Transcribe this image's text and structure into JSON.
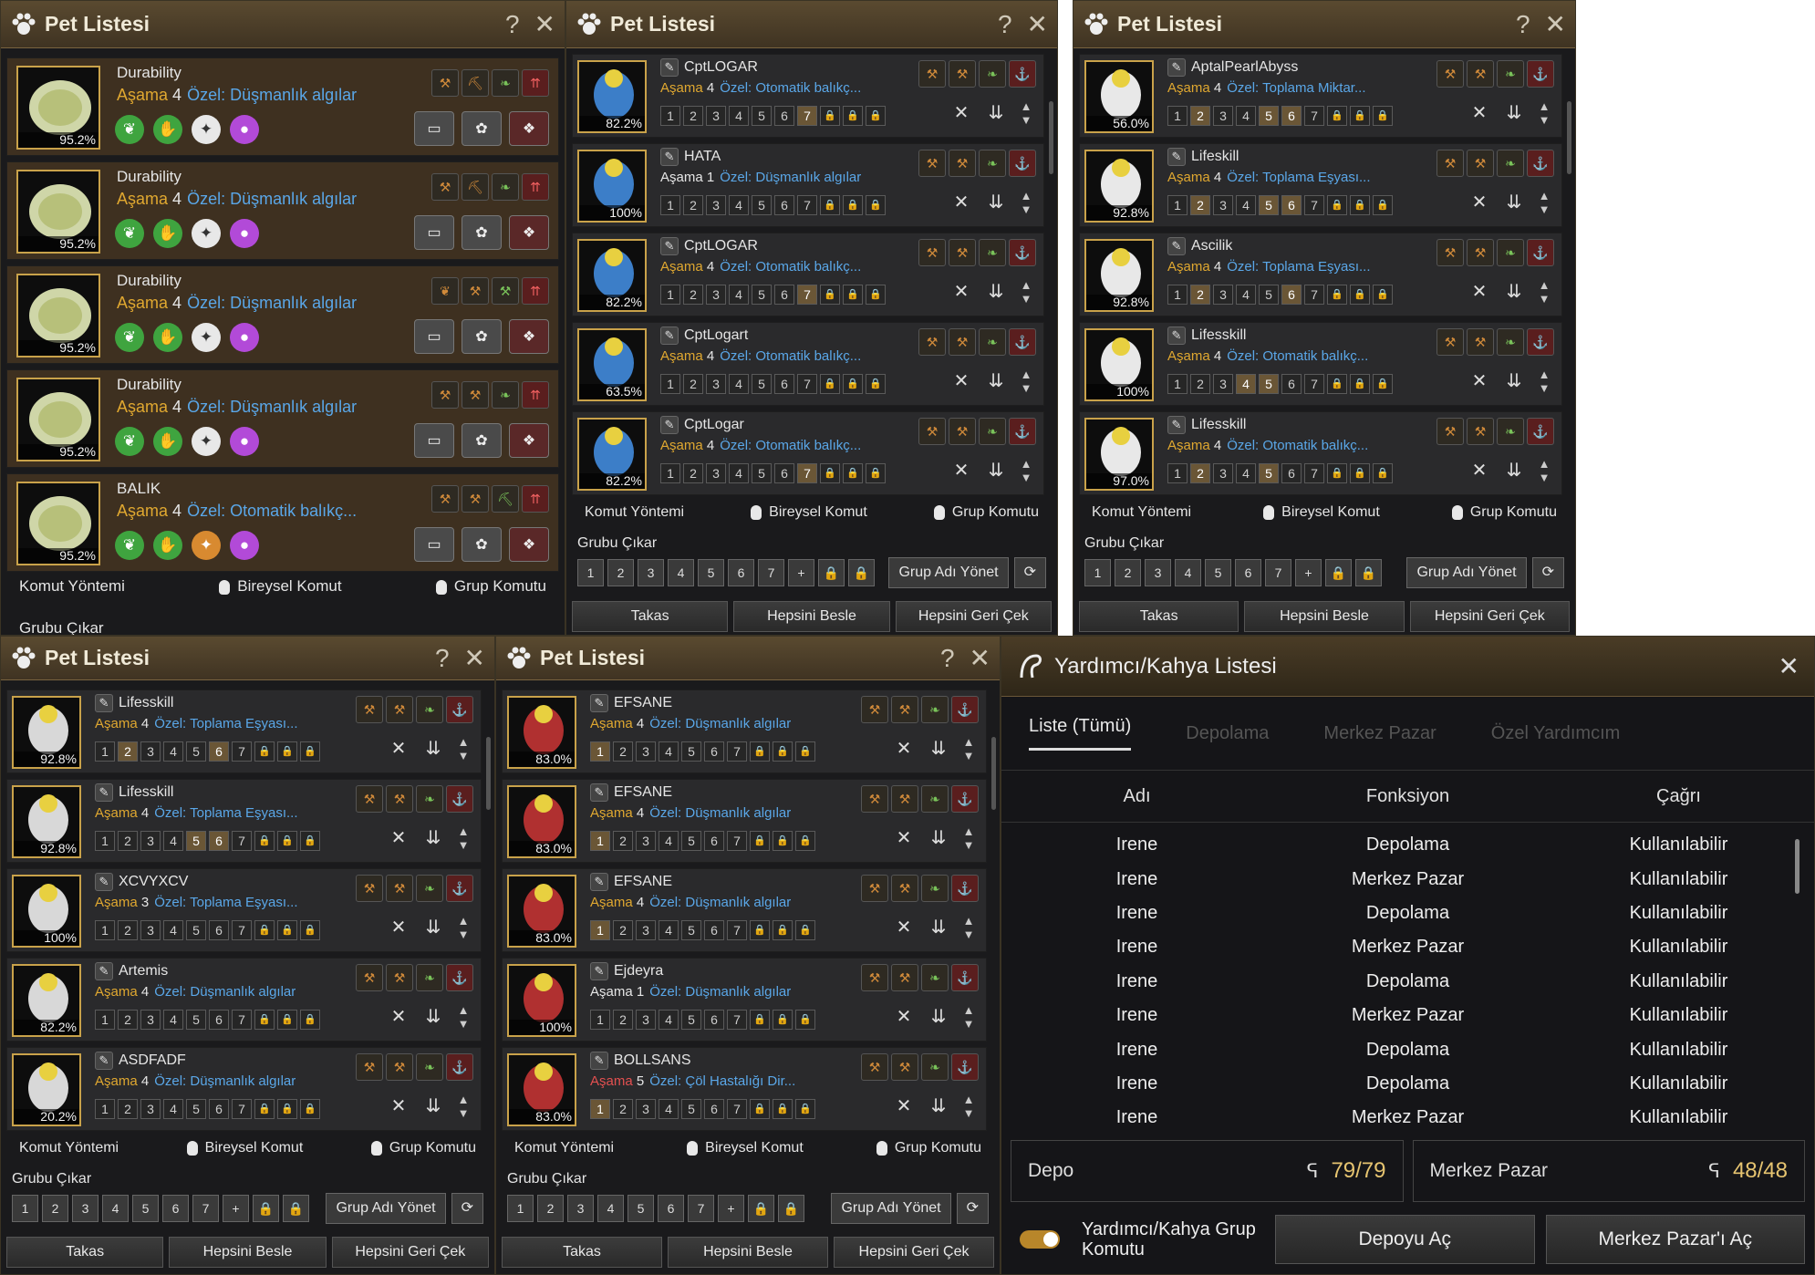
{
  "windows": [
    {
      "title": "Pet Listesi",
      "pets": [
        {
          "name": "Durability",
          "stage_label": "Aşama",
          "stage": "4",
          "special": "Özel: Düşmanlık algılar",
          "pct": "95.2%"
        },
        {
          "name": "Durability",
          "stage_label": "Aşama",
          "stage": "4",
          "special": "Özel: Düşmanlık algılar",
          "pct": "95.2%"
        },
        {
          "name": "Durability",
          "stage_label": "Aşama",
          "stage": "4",
          "special": "Özel: Düşmanlık algılar",
          "pct": "95.2%"
        },
        {
          "name": "Durability",
          "stage_label": "Aşama",
          "stage": "4",
          "special": "Özel: Düşmanlık algılar",
          "pct": "95.2%"
        },
        {
          "name": "BALIK",
          "stage_label": "Aşama",
          "stage": "4",
          "special": "Özel: Otomatik balıkç...",
          "pct": "95.2%"
        }
      ],
      "command_method": "Komut Yöntemi",
      "individual": "Bireysel Komut",
      "group": "Grup Komutu",
      "group_remove": "Grubu Çıkar"
    },
    {
      "title": "Pet Listesi",
      "pets": [
        {
          "name": "CptLOGAR",
          "stage_label": "Aşama",
          "stage": "4",
          "special": "Özel: Otomatik balıkç...",
          "pct": "82.2%"
        },
        {
          "name": "HATA",
          "stage_label": "Aşama",
          "stage": "1",
          "special": "Özel: Düşmanlık algılar",
          "pct": "100%"
        },
        {
          "name": "CptLOGAR",
          "stage_label": "Aşama",
          "stage": "4",
          "special": "Özel: Otomatik balıkç...",
          "pct": "82.2%"
        },
        {
          "name": "CptLogart",
          "stage_label": "Aşama",
          "stage": "4",
          "special": "Özel: Otomatik balıkç...",
          "pct": "63.5%"
        },
        {
          "name": "CptLogar",
          "stage_label": "Aşama",
          "stage": "4",
          "special": "Özel: Otomatik balıkç...",
          "pct": "82.2%"
        }
      ],
      "command_method": "Komut Yöntemi",
      "individual": "Bireysel Komut",
      "group": "Grup Komutu",
      "group_remove": "Grubu Çıkar",
      "manage": "Grup Adı Yönet",
      "trade": "Takas",
      "feed": "Hepsini Besle",
      "recall": "Hepsini Geri Çek"
    },
    {
      "title": "Pet Listesi",
      "pets": [
        {
          "name": "AptalPearlAbyss",
          "stage_label": "Aşama",
          "stage": "4",
          "special": "Özel: Toplama Miktar...",
          "pct": "56.0%"
        },
        {
          "name": "Lifeskill",
          "stage_label": "Aşama",
          "stage": "4",
          "special": "Özel: Toplama Eşyası...",
          "pct": "92.8%"
        },
        {
          "name": "Ascilik",
          "stage_label": "Aşama",
          "stage": "4",
          "special": "Özel: Toplama Eşyası...",
          "pct": "92.8%"
        },
        {
          "name": "Lifesskill",
          "stage_label": "Aşama",
          "stage": "4",
          "special": "Özel: Otomatik balıkç...",
          "pct": "100%"
        },
        {
          "name": "Lifesskill",
          "stage_label": "Aşama",
          "stage": "4",
          "special": "Özel: Otomatik balıkç...",
          "pct": "97.0%"
        }
      ],
      "command_method": "Komut Yöntemi",
      "individual": "Bireysel Komut",
      "group": "Grup Komutu",
      "group_remove": "Grubu Çıkar",
      "manage": "Grup Adı Yönet",
      "trade": "Takas",
      "feed": "Hepsini Besle",
      "recall": "Hepsini Geri Çek"
    },
    {
      "title": "Pet Listesi",
      "pets": [
        {
          "name": "Lifesskill",
          "stage_label": "Aşama",
          "stage": "4",
          "special": "Özel: Toplama Eşyası...",
          "pct": "92.8%"
        },
        {
          "name": "Lifesskill",
          "stage_label": "Aşama",
          "stage": "4",
          "special": "Özel: Toplama Eşyası...",
          "pct": "92.8%"
        },
        {
          "name": "XCVYXCV",
          "stage_label": "Aşama",
          "stage": "3",
          "special": "Özel: Toplama Eşyası...",
          "pct": "100%"
        },
        {
          "name": "Artemis",
          "stage_label": "Aşama",
          "stage": "4",
          "special": "Özel: Düşmanlık algılar",
          "pct": "82.2%"
        },
        {
          "name": "ASDFADF",
          "stage_label": "Aşama",
          "stage": "4",
          "special": "Özel: Düşmanlık algılar",
          "pct": "20.2%"
        }
      ],
      "command_method": "Komut Yöntemi",
      "individual": "Bireysel Komut",
      "group": "Grup Komutu",
      "group_remove": "Grubu Çıkar",
      "manage": "Grup Adı Yönet",
      "trade": "Takas",
      "feed": "Hepsini Besle",
      "recall": "Hepsini Geri Çek"
    },
    {
      "title": "Pet Listesi",
      "pets": [
        {
          "name": "EFSANE",
          "stage_label": "Aşama",
          "stage": "4",
          "special": "Özel: Düşmanlık algılar",
          "pct": "83.0%"
        },
        {
          "name": "EFSANE",
          "stage_label": "Aşama",
          "stage": "4",
          "special": "Özel: Düşmanlık algılar",
          "pct": "83.0%"
        },
        {
          "name": "EFSANE",
          "stage_label": "Aşama",
          "stage": "4",
          "special": "Özel: Düşmanlık algılar",
          "pct": "83.0%"
        },
        {
          "name": "Ejdeyra",
          "stage_label": "Aşama",
          "stage": "1",
          "special": "Özel: Düşmanlık algılar",
          "pct": "100%"
        },
        {
          "name": "BOLLSANS",
          "stage_label": "Aşama",
          "stage": "5",
          "special": "Özel: Çöl Hastalığı Dir...",
          "pct": "83.0%"
        }
      ],
      "command_method": "Komut Yöntemi",
      "individual": "Bireysel Komut",
      "group": "Grup Komutu",
      "group_remove": "Grubu Çıkar",
      "manage": "Grup Adı Yönet",
      "trade": "Takas",
      "feed": "Hepsini Besle",
      "recall": "Hepsini Geri Çek"
    }
  ],
  "group_slots": [
    "1",
    "2",
    "3",
    "4",
    "5",
    "6",
    "7"
  ],
  "helper": {
    "title": "Yardımcı/Kahya Listesi",
    "tabs": [
      "Liste (Tümü)",
      "Depolama",
      "Merkez Pazar",
      "Özel Yardımcım"
    ],
    "columns": [
      "Adı",
      "Fonksiyon",
      "Çağrı"
    ],
    "rows": [
      [
        "Irene",
        "Depolama",
        "Kullanılabilir"
      ],
      [
        "Irene",
        "Merkez Pazar",
        "Kullanılabilir"
      ],
      [
        "Irene",
        "Depolama",
        "Kullanılabilir"
      ],
      [
        "Irene",
        "Merkez Pazar",
        "Kullanılabilir"
      ],
      [
        "Irene",
        "Depolama",
        "Kullanılabilir"
      ],
      [
        "Irene",
        "Merkez Pazar",
        "Kullanılabilir"
      ],
      [
        "Irene",
        "Depolama",
        "Kullanılabilir"
      ],
      [
        "Irene",
        "Depolama",
        "Kullanılabilir"
      ],
      [
        "Irene",
        "Merkez Pazar",
        "Kullanılabilir"
      ]
    ],
    "depo_label": "Depo",
    "depo_count": "79/79",
    "market_label": "Merkez Pazar",
    "market_count": "48/48",
    "toggle_label": "Yardımcı/Kahya Grup Komutu",
    "open_depo": "Depoyu Aç",
    "open_market": "Merkez Pazar'ı Aç"
  }
}
